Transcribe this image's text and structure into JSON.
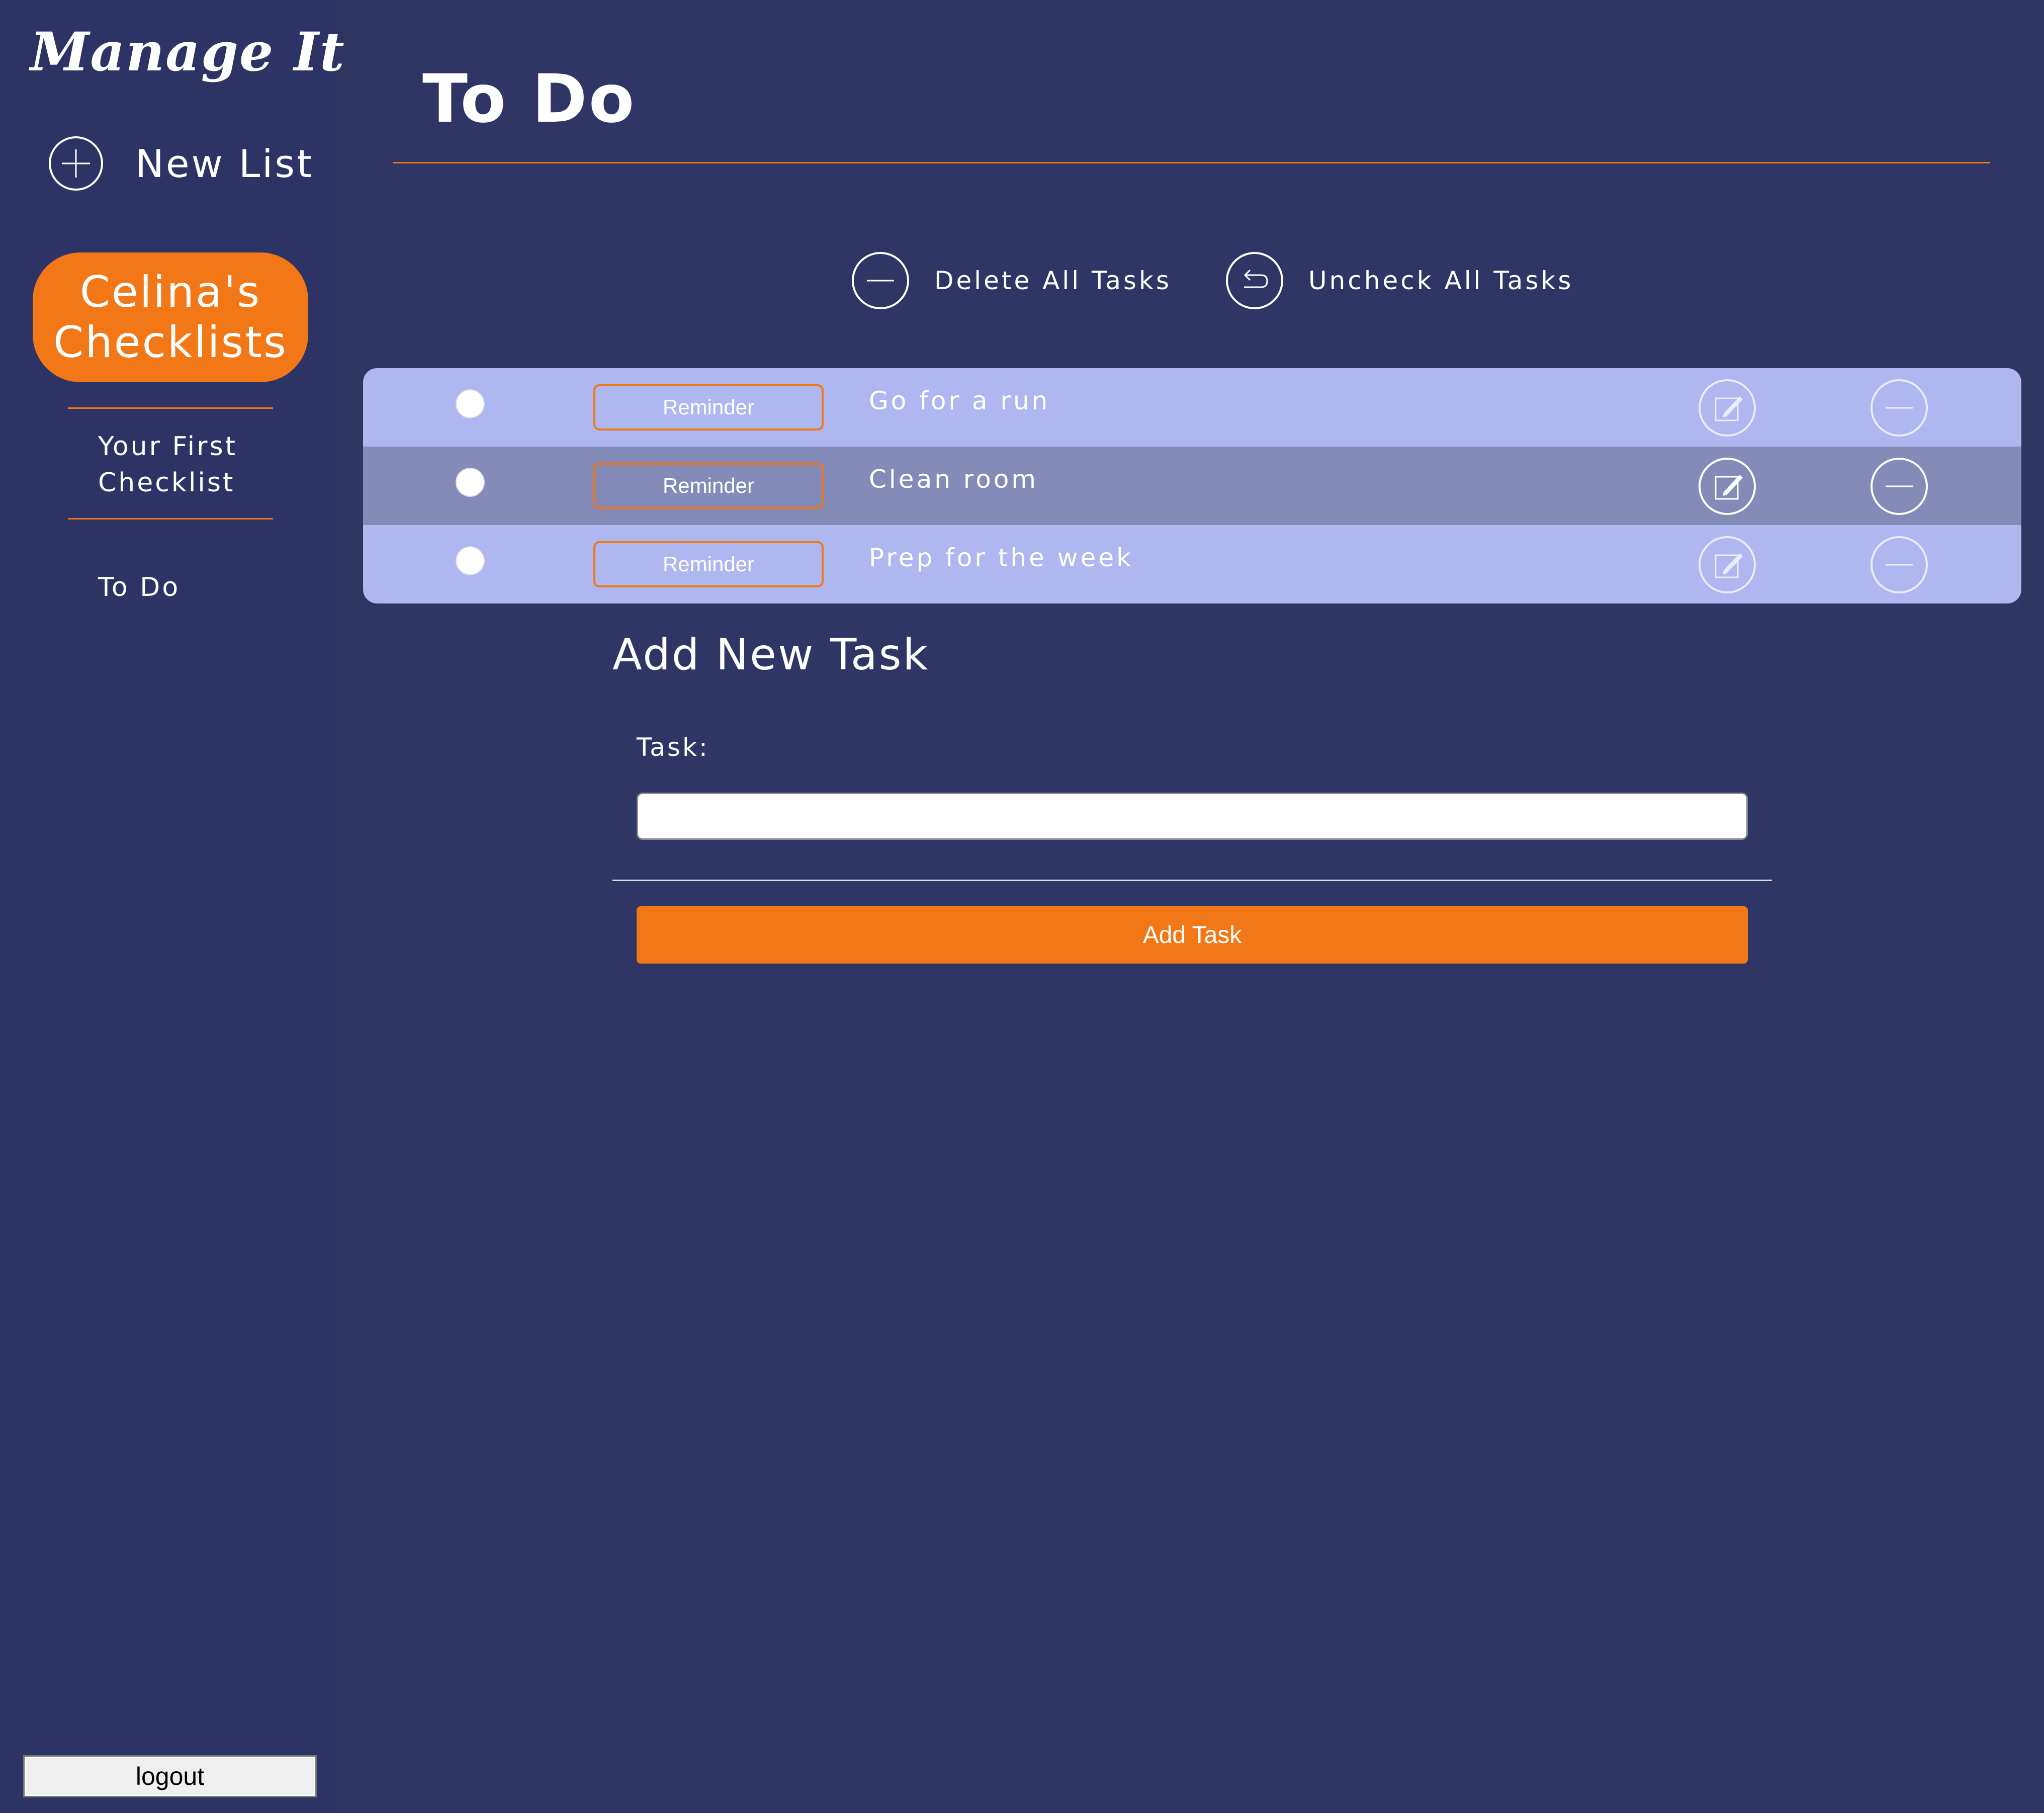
{
  "app": {
    "brand": "Manage It",
    "new_list_label": "New List",
    "user_checklists_label": "Celina's Checklists",
    "logout_label": "logout"
  },
  "sidebar": {
    "items": [
      {
        "label": "Your First Checklist"
      },
      {
        "label": "To Do"
      }
    ]
  },
  "main": {
    "title": "To Do",
    "actions": {
      "delete_all": "Delete All Tasks",
      "uncheck_all": "Uncheck All Tasks"
    },
    "tasks": [
      {
        "text": "Go for a run",
        "reminder_label": "Reminder"
      },
      {
        "text": "Clean room",
        "reminder_label": "Reminder"
      },
      {
        "text": "Prep for the week",
        "reminder_label": "Reminder"
      }
    ],
    "form": {
      "heading": "Add New Task",
      "task_label": "Task:",
      "task_value": "",
      "submit_label": "Add Task"
    }
  },
  "colors": {
    "accent": "#f27716",
    "background": "#2f3561",
    "sidebar": "#2d3364",
    "row_light": "#aeb7ef",
    "row_dark": "#848bb8"
  },
  "icons": {
    "new_list": "plus-circle-icon",
    "delete_all": "minus-circle-icon",
    "uncheck_all": "undo-circle-icon",
    "edit": "edit-icon",
    "delete": "minus-circle-icon"
  }
}
